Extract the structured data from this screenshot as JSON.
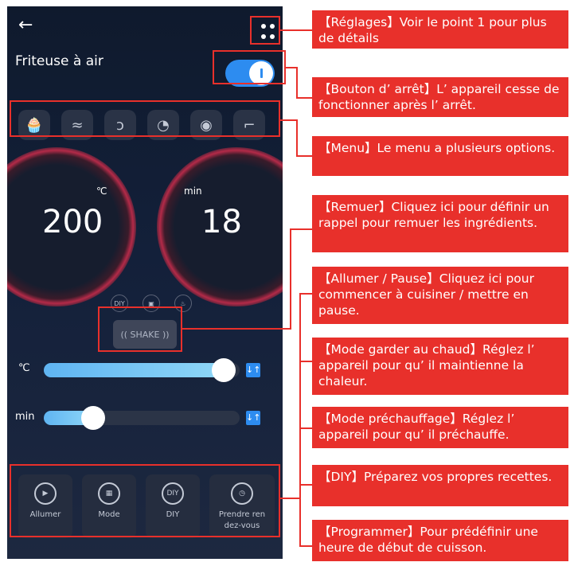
{
  "app": {
    "title": "Friteuse à air",
    "back_icon": "arrow-left-icon",
    "settings_icon": "grid-dots-icon",
    "power_toggle_on": true
  },
  "menu_icons": [
    "cupcake-icon",
    "bacon-icon",
    "shrimp-icon",
    "chicken-leg-icon",
    "steak-icon",
    "boot-icon"
  ],
  "dials": {
    "temperature": {
      "unit": "℃",
      "value": "200"
    },
    "time": {
      "unit": "min",
      "value": "18"
    }
  },
  "mini_icons": [
    {
      "icon": "diy-icon",
      "label": "DIY"
    },
    {
      "icon": "keep-warm-icon",
      "label": ""
    },
    {
      "icon": "flame-icon",
      "label": ""
    }
  ],
  "shake_label": "(( SHAKE ))",
  "sliders": {
    "temperature": {
      "label": "℃",
      "level": 0.92
    },
    "time": {
      "label": "min",
      "level": 0.25
    }
  },
  "bottom_buttons": [
    {
      "icon": "play-icon",
      "label": "Allumer"
    },
    {
      "icon": "mode-grid-icon",
      "label": "Mode"
    },
    {
      "icon": "diy-icon",
      "label": "DIY"
    },
    {
      "icon": "timer-icon",
      "label": "Prendre ren dez-vous"
    }
  ],
  "callouts": [
    "【Réglages】Voir le point 1 pour plus de détails",
    "【Bouton d’ arrêt】L’ appareil cesse de fonctionner après l’ arrêt.",
    "【Menu】Le menu a plusieurs options.",
    "【Remuer】Cliquez ici pour définir un rappel pour remuer les ingrédients.",
    "【Allumer / Pause】Cliquez ici pour commencer à cuisiner / mettre en pause.",
    "【Mode garder au chaud】Réglez l’ appareil pour qu’ il maintienne la chaleur.",
    "【Mode préchauffage】Réglez l’ appareil pour qu’ il préchauffe.",
    "【DIY】Préparez vos propres recettes.",
    "【Programmer】Pour prédéfinir une heure de début de cuisson."
  ],
  "colors": {
    "accent": "#2d8cf0",
    "highlight": "#e8302b",
    "background": "#13203a"
  }
}
